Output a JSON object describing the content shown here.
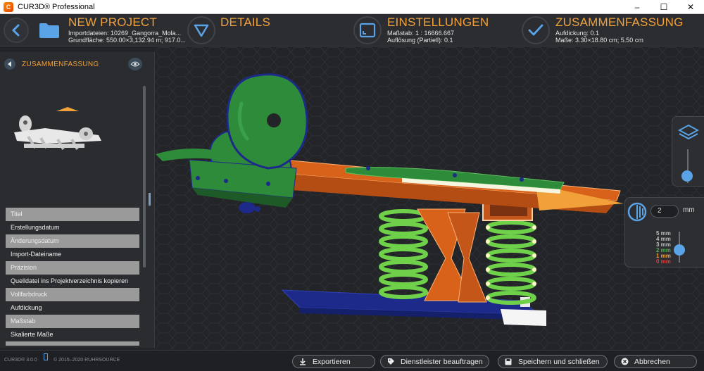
{
  "window": {
    "logo_letter": "C",
    "title": "CUR3D® Professional",
    "minimize": "–",
    "maximize": "☐",
    "close": "✕"
  },
  "steps": {
    "project": {
      "title": "NEW PROJECT",
      "line1": "Importdateien: 10269_Gangorra_Mola...",
      "line2": "Grundfläche: 550.00×3,132.94 m; 917.0..."
    },
    "details": {
      "title": "DETAILS"
    },
    "settings": {
      "title": "EINSTELLUNGEN",
      "line1": "Maßstab: 1 : 16666.667",
      "line2": "Auflösung (Partiell): 0.1"
    },
    "summary": {
      "title": "ZUSAMMENFASSUNG",
      "line1": "Aufdickung: 0.1",
      "line2": "Maße: 3.30×18.80 cm; 5.50 cm"
    }
  },
  "sidebar": {
    "title": "ZUSAMMENFASSUNG",
    "rows": [
      {
        "label": "Titel",
        "kind": "cat"
      },
      {
        "label": "Erstellungsdatum",
        "kind": "item"
      },
      {
        "label": "Änderungsdatum",
        "kind": "cat"
      },
      {
        "label": "Import-Dateiname",
        "kind": "item"
      },
      {
        "label": "Präzision",
        "kind": "cat"
      },
      {
        "label": "Quelldatei ins Projektverzeichnis kopieren",
        "kind": "item"
      },
      {
        "label": "Vollfarbdruck",
        "kind": "cat"
      },
      {
        "label": "Aufdickung",
        "kind": "item"
      },
      {
        "label": "Maßstab",
        "kind": "cat"
      },
      {
        "label": "Skalierte Maße",
        "kind": "item"
      }
    ]
  },
  "thickness": {
    "value": "2",
    "unit": "mm",
    "scale": [
      "5 mm",
      "4 mm",
      "3 mm",
      "2 mm",
      "1 mm",
      "0 mm"
    ],
    "scale_colors": [
      "#bdbdbd",
      "#bdbdbd",
      "#bdbdbd",
      "#4caf50",
      "#f2a13a",
      "#e53935"
    ],
    "level_fraction": 0.4
  },
  "layer_slider_fraction": 0.2,
  "footer": {
    "version": "CUR3D® 3.0.0",
    "copyright": "© 2015–2020 RUHRSOURCE"
  },
  "actions": {
    "export": "Exportieren",
    "service": "Dienstleister beauftragen",
    "save_close": "Speichern und schließen",
    "cancel": "Abbrechen"
  },
  "colors": {
    "accent": "#f2a13a",
    "icon_blue": "#5aa3e6",
    "model_green": "#2e8b3a",
    "model_orange": "#d9621a",
    "model_navy": "#1d2a8a",
    "spring_green": "#6fd04a"
  }
}
